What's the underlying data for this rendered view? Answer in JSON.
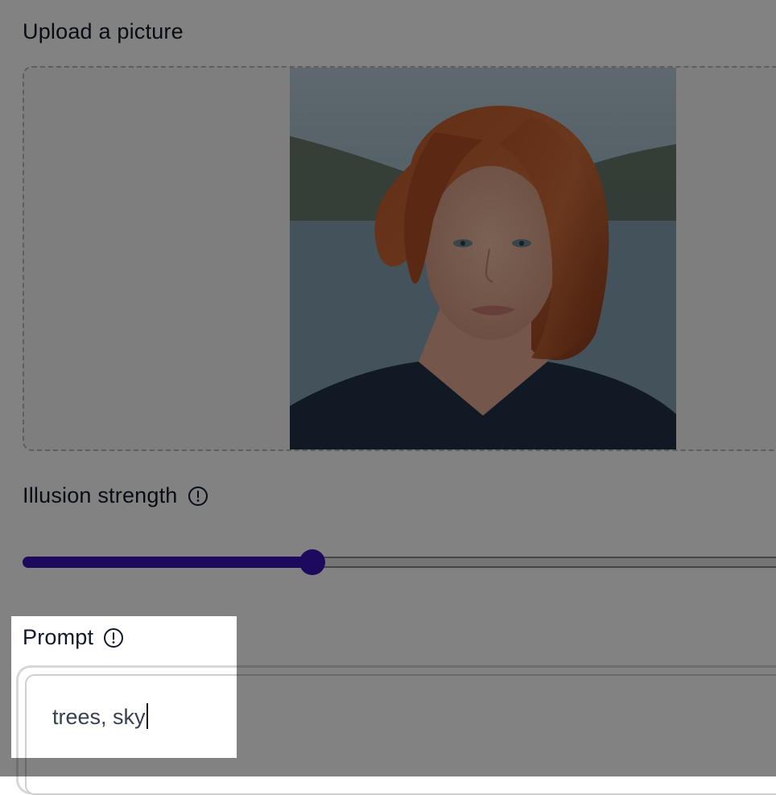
{
  "upload": {
    "label": "Upload a picture"
  },
  "illusion": {
    "label": "Illusion strength",
    "info_icon": "info-circle-icon",
    "value_fraction": 0.375
  },
  "prompt": {
    "label": "Prompt",
    "info_icon": "info-circle-icon",
    "value": "trees, sky"
  },
  "colors": {
    "accent": "#3a13b8",
    "overlay": "rgba(0,0,0,0.49)"
  }
}
